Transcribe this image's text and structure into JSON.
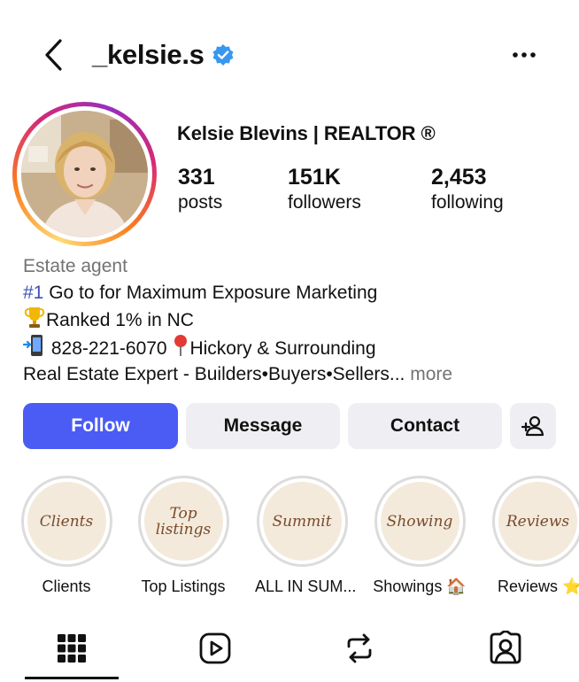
{
  "header": {
    "username": "_kelsie.s",
    "verified": true
  },
  "profile": {
    "full_name": "Kelsie Blevins | REALTOR ®",
    "stats": [
      {
        "value": "331",
        "label": "posts"
      },
      {
        "value": "151K",
        "label": "followers"
      },
      {
        "value": "2,453",
        "label": "following"
      }
    ]
  },
  "bio": {
    "category": "Estate agent",
    "line1_hash": "#1",
    "line1_rest": " Go to for Maximum Exposure Marketing",
    "line2": "Ranked 1% in NC",
    "line3_phone": " 828-221-6070 ",
    "line3_place": "Hickory & Surrounding",
    "line4": "Real Estate Expert - Builders•Buyers•Sellers...",
    "more": " more"
  },
  "actions": {
    "follow": "Follow",
    "message": "Message",
    "contact": "Contact"
  },
  "highlights": [
    {
      "cover_text": "Clients",
      "label": "Clients"
    },
    {
      "cover_text": "Top listings",
      "label": "Top Listings"
    },
    {
      "cover_text": "Summit",
      "label": "ALL IN SUM..."
    },
    {
      "cover_text": "Showing",
      "label": "Showings 🏠"
    },
    {
      "cover_text": "Reviews",
      "label": "Reviews ⭐"
    }
  ],
  "tabs": [
    "grid-icon",
    "reels-icon",
    "reposts-icon",
    "tagged-icon"
  ],
  "colors": {
    "follow_button": "#4a5cf4",
    "verified_badge": "#3897f0",
    "hashtag": "#3f51b5"
  }
}
